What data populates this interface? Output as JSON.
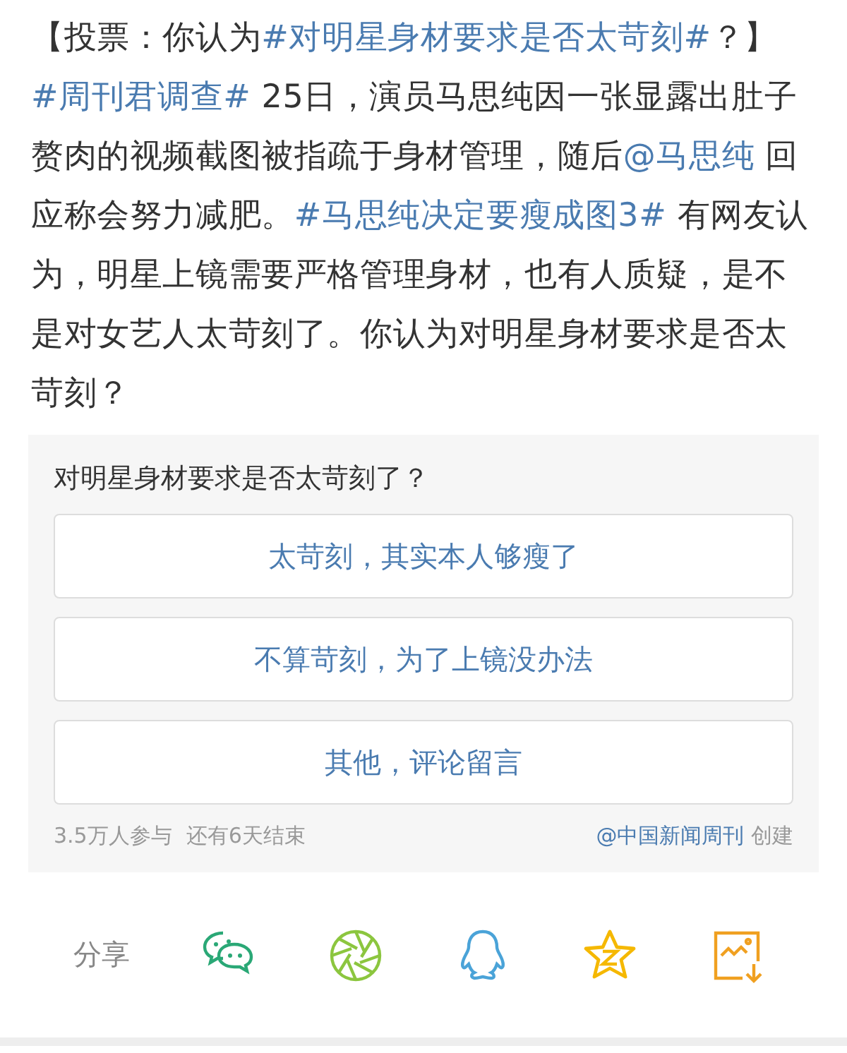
{
  "post": {
    "segments": [
      {
        "kind": "text",
        "text": "【投票：你认为"
      },
      {
        "kind": "link",
        "text": "#对明星身材要求是否太苛刻#"
      },
      {
        "kind": "text",
        "text": "？】"
      },
      {
        "kind": "link",
        "text": "#周刊君调查#"
      },
      {
        "kind": "text",
        "text": " 25日，演员马思纯因一张显露出肚子赘肉的视频截图被指疏于身材管理，随后"
      },
      {
        "kind": "link",
        "text": "@马思纯"
      },
      {
        "kind": "text",
        "text": " 回应称会努力减肥。"
      },
      {
        "kind": "link",
        "text": "#马思纯决定要瘦成图3#"
      },
      {
        "kind": "text",
        "text": " 有网友认为，明星上镜需要严格管理身材，也有人质疑，是不是对女艺人太苛刻了。你认为对明星身材要求是否太苛刻？"
      }
    ]
  },
  "poll": {
    "question": "对明星身材要求是否太苛刻了？",
    "options": [
      "太苛刻，其实本人够瘦了",
      "不算苛刻，为了上镜没办法",
      "其他，评论留言"
    ],
    "participants": "3.5万人参与",
    "remaining": "还有6天结束",
    "creator": "@中国新闻周刊",
    "created_label": "创建"
  },
  "share": {
    "label": "分享",
    "targets": [
      {
        "kind": "wechat"
      },
      {
        "kind": "moments"
      },
      {
        "kind": "qq"
      },
      {
        "kind": "qzone"
      },
      {
        "kind": "save"
      }
    ]
  }
}
